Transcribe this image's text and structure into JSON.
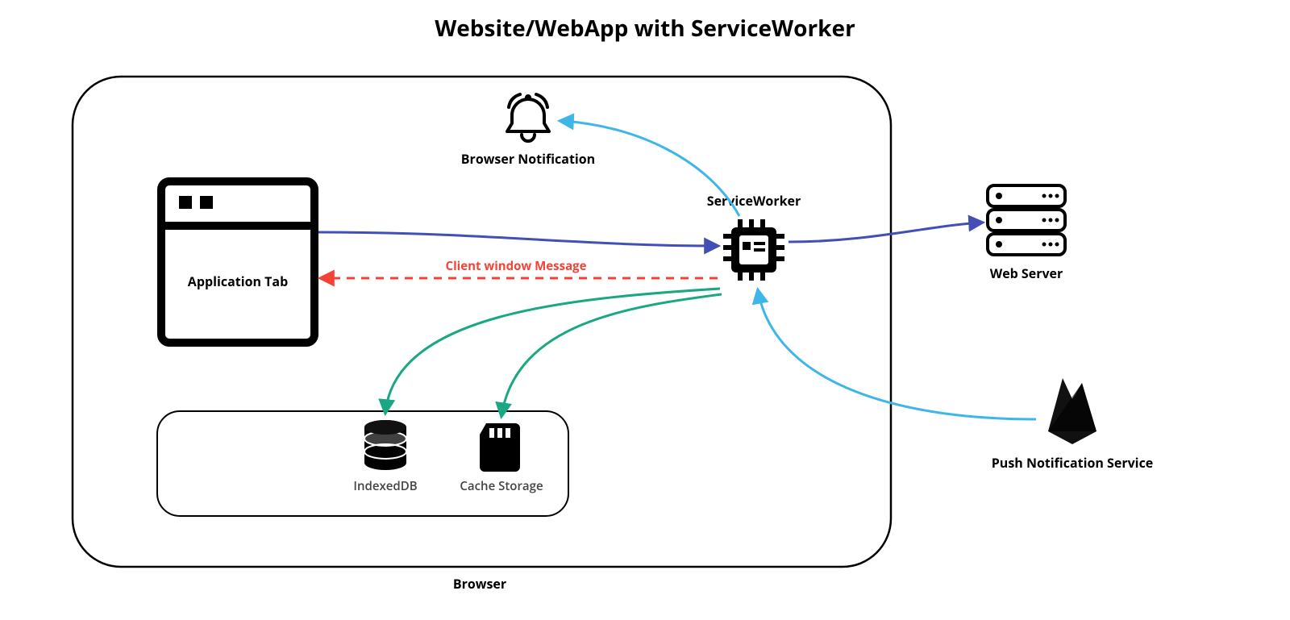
{
  "diagram": {
    "title": "Website/WebApp with ServiceWorker",
    "container_label": "Browser",
    "nodes": {
      "app_tab": "Application Tab",
      "browser_notification": "Browser Notification",
      "service_worker": "ServiceWorker",
      "indexeddb": "IndexedDB",
      "cache_storage": "Cache Storage",
      "web_server": "Web Server",
      "push_service": "Push Notification Service"
    },
    "edges": {
      "client_window_message": "Client window Message"
    },
    "colors": {
      "violet": "#4250b5",
      "teal": "#1aa783",
      "cyan": "#3fb6e8",
      "red": "#f44336",
      "black": "#000000"
    }
  }
}
